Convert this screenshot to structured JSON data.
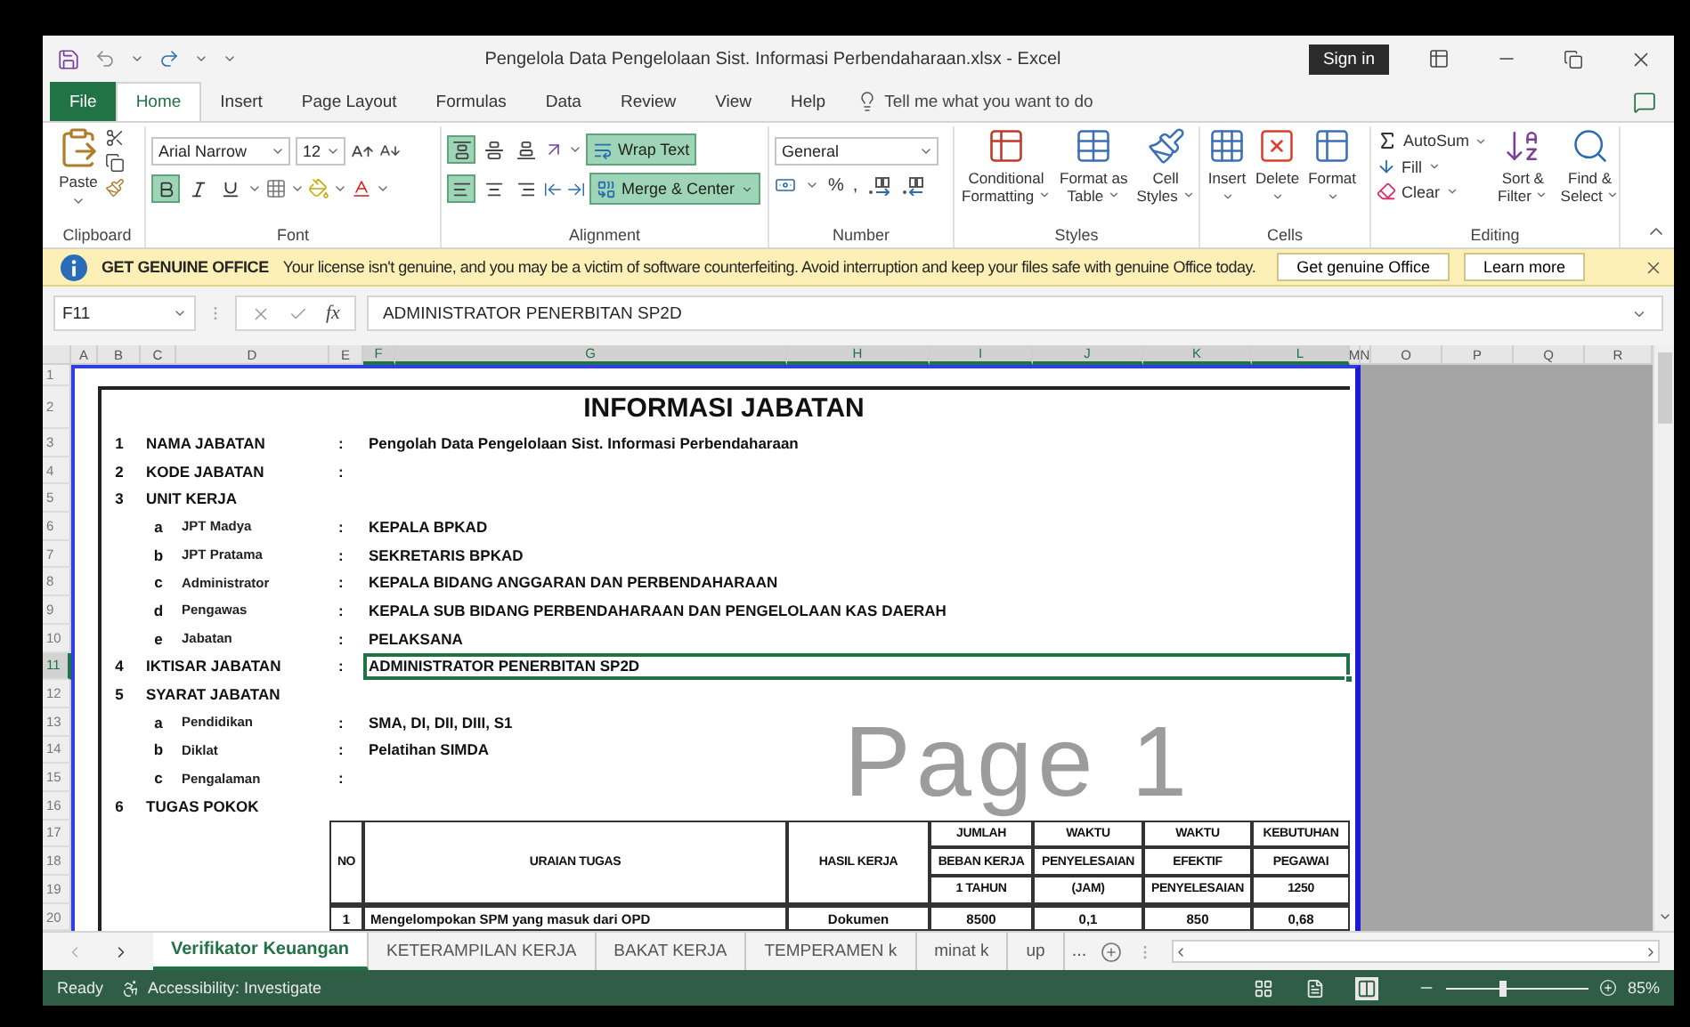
{
  "window": {
    "title": "Pengelola Data Pengelolaan Sist. Informasi Perbendaharaan.xlsx  -  Excel",
    "sign_in": "Sign in"
  },
  "tabs": [
    {
      "label": "File",
      "kind": "file",
      "selected": false
    },
    {
      "label": "Home",
      "kind": "tab",
      "selected": true
    },
    {
      "label": "Insert",
      "kind": "tab",
      "selected": false
    },
    {
      "label": "Page Layout",
      "kind": "tab",
      "selected": false
    },
    {
      "label": "Formulas",
      "kind": "tab",
      "selected": false
    },
    {
      "label": "Data",
      "kind": "tab",
      "selected": false
    },
    {
      "label": "Review",
      "kind": "tab",
      "selected": false
    },
    {
      "label": "View",
      "kind": "tab",
      "selected": false
    },
    {
      "label": "Help",
      "kind": "tab",
      "selected": false
    }
  ],
  "tell_me": "Tell me what you want to do",
  "ribbon": {
    "clipboard": {
      "label": "Clipboard",
      "paste": "Paste"
    },
    "font": {
      "label": "Font",
      "name": "Arial Narrow",
      "size": "12",
      "styles": [
        {
          "kind": "bold",
          "on": true
        },
        {
          "kind": "italic",
          "on": false
        },
        {
          "kind": "underline",
          "on": false
        }
      ]
    },
    "alignment": {
      "label": "Alignment",
      "buttons": [
        {
          "kind": "top",
          "on": true
        },
        {
          "kind": "middle",
          "on": false
        },
        {
          "kind": "bottom",
          "on": false
        },
        {
          "kind": "left",
          "on": true
        },
        {
          "kind": "center",
          "on": false
        },
        {
          "kind": "right",
          "on": false
        }
      ],
      "wrap_text": {
        "label": "Wrap Text",
        "on": true
      },
      "merge": {
        "label": "Merge & Center",
        "on": true
      }
    },
    "number": {
      "label": "Number",
      "format": "General",
      "percent": "%",
      "comma": ","
    },
    "styles": {
      "label": "Styles",
      "buttons": [
        {
          "line1": "Conditional",
          "line2": "Formatting"
        },
        {
          "line1": "Format as",
          "line2": "Table"
        },
        {
          "line1": "Cell",
          "line2": "Styles"
        }
      ]
    },
    "cells": {
      "label": "Cells",
      "buttons": [
        "Insert",
        "Delete",
        "Format"
      ]
    },
    "editing": {
      "label": "Editing",
      "autosum": "AutoSum",
      "fill": "Fill",
      "clear": "Clear",
      "sort": {
        "line1": "Sort &",
        "line2": "Filter"
      },
      "find": {
        "line1": "Find &",
        "line2": "Select"
      }
    }
  },
  "message_bar": {
    "title": "GET GENUINE OFFICE",
    "text": "Your license isn't genuine, and you may be a victim of software counterfeiting. Avoid interruption and keep your files safe with genuine Office today.",
    "buttons": [
      "Get genuine Office",
      "Learn more"
    ]
  },
  "formula_bar": {
    "name_box": "F11",
    "function_label": "fx",
    "value": "ADMINISTRATOR PENERBITAN SP2D"
  },
  "sheet": {
    "columns": [
      "A",
      "B",
      "C",
      "D",
      "E",
      "F",
      "G",
      "H",
      "I",
      "J",
      "K",
      "L",
      "M",
      "N",
      "O",
      "P",
      "Q",
      "R"
    ],
    "watermark": "Page 1",
    "rows": [
      {
        "number": "1",
        "kind": "blank",
        "selected": false,
        "cells": []
      },
      {
        "number": "2",
        "kind": "title",
        "selected": false,
        "cells": [
          "",
          "",
          "",
          "",
          "",
          "",
          "INFORMASI  JABATAN"
        ]
      },
      {
        "number": "3",
        "kind": "field",
        "selected": false,
        "cells": [
          "",
          "1",
          "NAMA JABATAN",
          "",
          ":",
          "Pengolah Data Pengelolaan Sist. Informasi Perbendaharaan"
        ]
      },
      {
        "number": "4",
        "kind": "field",
        "selected": false,
        "cells": [
          "",
          "2",
          "KODE JABATAN",
          "",
          ":"
        ]
      },
      {
        "number": "5",
        "kind": "field",
        "selected": false,
        "cells": [
          "",
          "3",
          "UNIT KERJA"
        ]
      },
      {
        "number": "6",
        "kind": "sub",
        "selected": false,
        "cells": [
          "",
          "",
          "a",
          "JPT Madya",
          ":",
          "KEPALA BPKAD"
        ]
      },
      {
        "number": "7",
        "kind": "sub",
        "selected": false,
        "cells": [
          "",
          "",
          "b",
          "JPT Pratama",
          ":",
          "SEKRETARIS BPKAD"
        ]
      },
      {
        "number": "8",
        "kind": "sub",
        "selected": false,
        "cells": [
          "",
          "",
          "c",
          "Administrator",
          ":",
          "KEPALA BIDANG ANGGARAN DAN PERBENDAHARAAN"
        ]
      },
      {
        "number": "9",
        "kind": "sub",
        "selected": false,
        "cells": [
          "",
          "",
          "d",
          "Pengawas",
          ":",
          "KEPALA SUB BIDANG PERBENDAHARAAN DAN PENGELOLAAN KAS DAERAH"
        ]
      },
      {
        "number": "10",
        "kind": "sub",
        "selected": false,
        "cells": [
          "",
          "",
          "e",
          "Jabatan",
          ":",
          "PELAKSANA"
        ]
      },
      {
        "number": "11",
        "kind": "field",
        "selected": true,
        "cells": [
          "",
          "4",
          "IKTISAR JABATAN",
          "",
          ":",
          "ADMINISTRATOR PENERBITAN SP2D"
        ]
      },
      {
        "number": "12",
        "kind": "field",
        "selected": false,
        "cells": [
          "",
          "5",
          "SYARAT JABATAN"
        ]
      },
      {
        "number": "13",
        "kind": "sub",
        "selected": false,
        "cells": [
          "",
          "",
          "a",
          "Pendidikan",
          ":",
          "SMA, DI, DII, DIII, S1"
        ]
      },
      {
        "number": "14",
        "kind": "sub",
        "selected": false,
        "cells": [
          "",
          "",
          "b",
          "Diklat",
          ":",
          "Pelatihan SIMDA"
        ]
      },
      {
        "number": "15",
        "kind": "sub",
        "selected": false,
        "cells": [
          "",
          "",
          "c",
          "Pengalaman",
          ":"
        ]
      },
      {
        "number": "16",
        "kind": "field",
        "selected": false,
        "cells": [
          "",
          "6",
          "TUGAS POKOK"
        ]
      },
      {
        "number": "17",
        "kind": "table-head",
        "selected": false,
        "cells": [
          "",
          "",
          "",
          "",
          "NO",
          "URAIAN TUGAS",
          "",
          "HASIL KERJA",
          "JUMLAH",
          "WAKTU",
          "WAKTU",
          "KEBUTUHAN"
        ]
      },
      {
        "number": "18",
        "kind": "table-head",
        "selected": false,
        "cells": [
          "",
          "",
          "",
          "",
          "",
          "",
          "",
          "",
          "BEBAN KERJA",
          "PENYELESAIAN",
          "EFEKTIF",
          "PEGAWAI"
        ]
      },
      {
        "number": "19",
        "kind": "table-head",
        "selected": false,
        "cells": [
          "",
          "",
          "",
          "",
          "",
          "",
          "",
          "",
          "1 TAHUN",
          "(JAM)",
          "PENYELESAIAN",
          "1250"
        ]
      },
      {
        "number": "20",
        "kind": "table-row",
        "selected": false,
        "cells": [
          "",
          "",
          "",
          "",
          "1",
          "Mengelompokan SPM yang masuk dari OPD",
          "",
          "Dokumen",
          "8500",
          "0,1",
          "850",
          "0,68"
        ]
      }
    ]
  },
  "sheet_tabs": {
    "tabs": [
      {
        "label": "Verifikator Keuangan",
        "selected": true
      },
      {
        "label": "KETERAMPILAN KERJA",
        "selected": false
      },
      {
        "label": "BAKAT KERJA",
        "selected": false
      },
      {
        "label": "TEMPERAMEN k",
        "selected": false
      },
      {
        "label": "minat k",
        "selected": false
      },
      {
        "label": "up",
        "selected": false
      }
    ],
    "more": "..."
  },
  "status_bar": {
    "ready": "Ready",
    "accessibility": "Accessibility: Investigate",
    "views": [
      {
        "kind": "normal",
        "selected": false
      },
      {
        "kind": "page-layout",
        "selected": false
      },
      {
        "kind": "page-break",
        "selected": true
      }
    ],
    "zoom": {
      "level": 0.4,
      "reading": "85%"
    }
  }
}
